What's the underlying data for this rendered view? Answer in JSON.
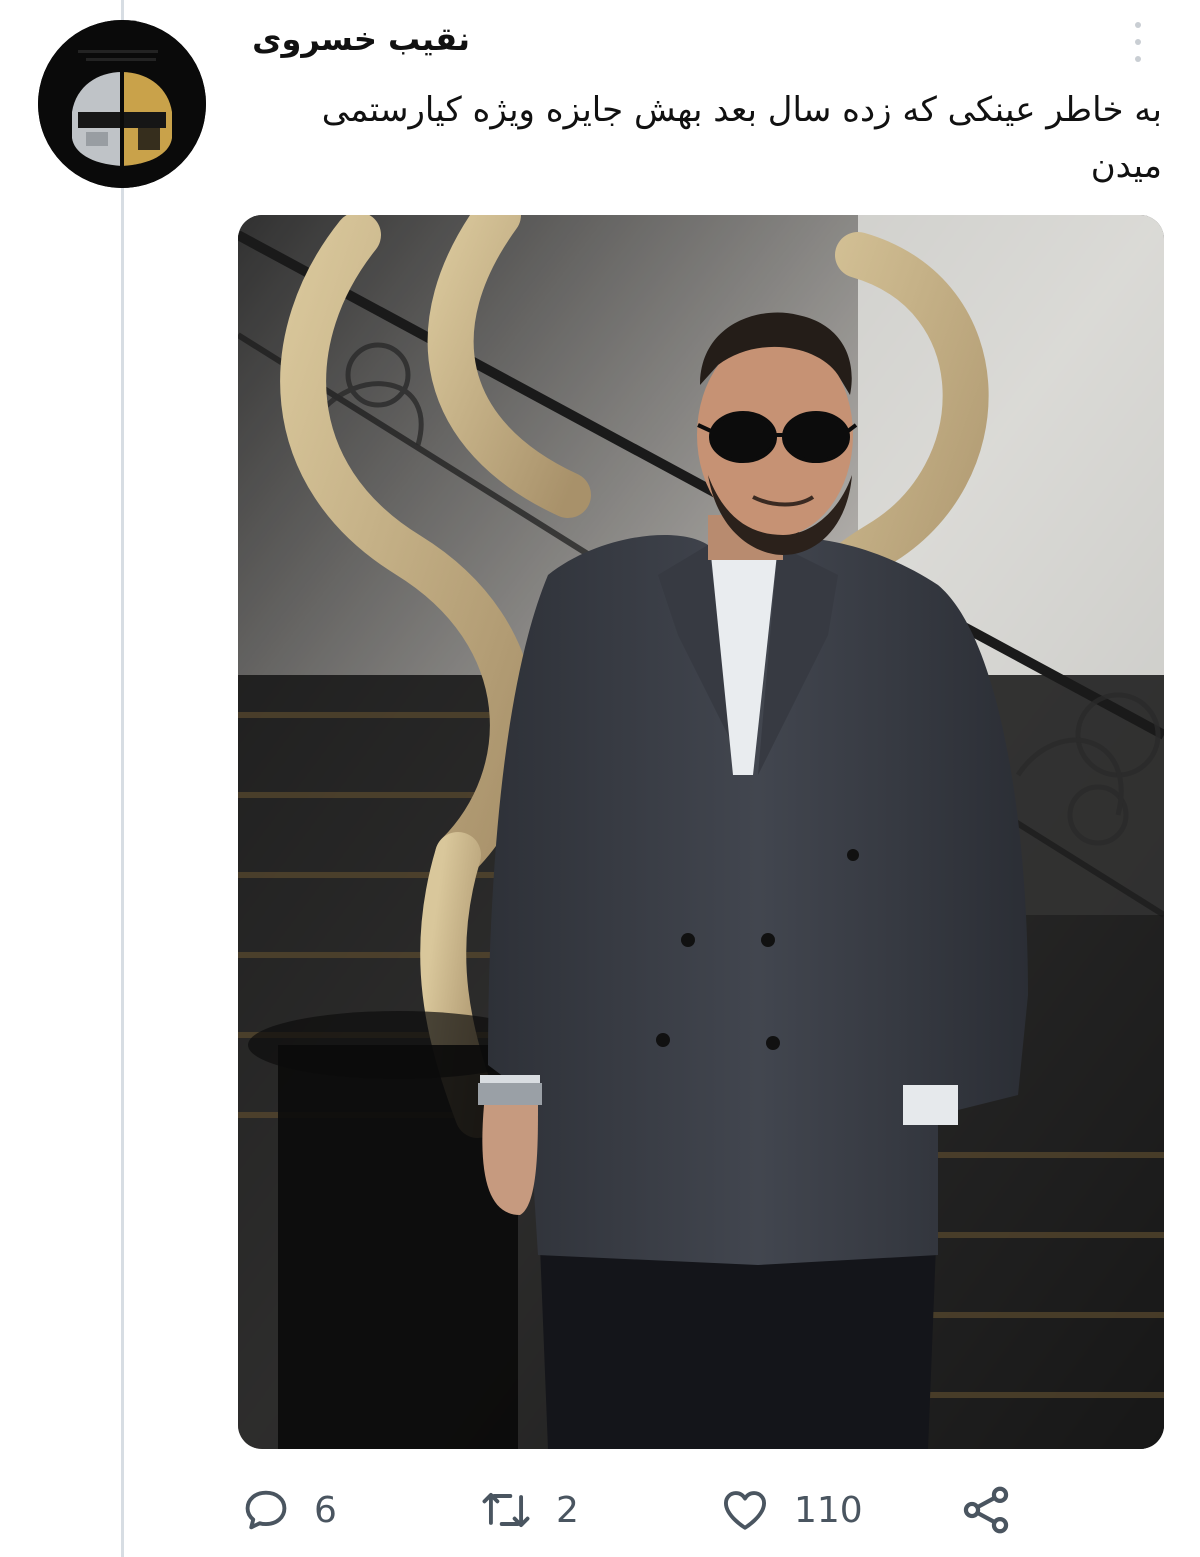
{
  "tweet": {
    "author": "نقیب خسروی",
    "text": "به خاطر عینکی که زده سال بعد بهش جایزه ویژه کیارستمی میدن",
    "avatar": "daft-punk-helmet-avatar",
    "image": "man-in-suit-sunglasses-photo"
  },
  "actions": {
    "reply": {
      "icon": "reply-icon",
      "count": "6"
    },
    "retweet": {
      "icon": "retweet-icon",
      "count": "2"
    },
    "like": {
      "icon": "heart-icon",
      "count": "110"
    },
    "share": {
      "icon": "share-icon"
    }
  },
  "colors": {
    "text": "#111111",
    "icon": "#4a5560",
    "thread_line": "#d7dde3"
  }
}
